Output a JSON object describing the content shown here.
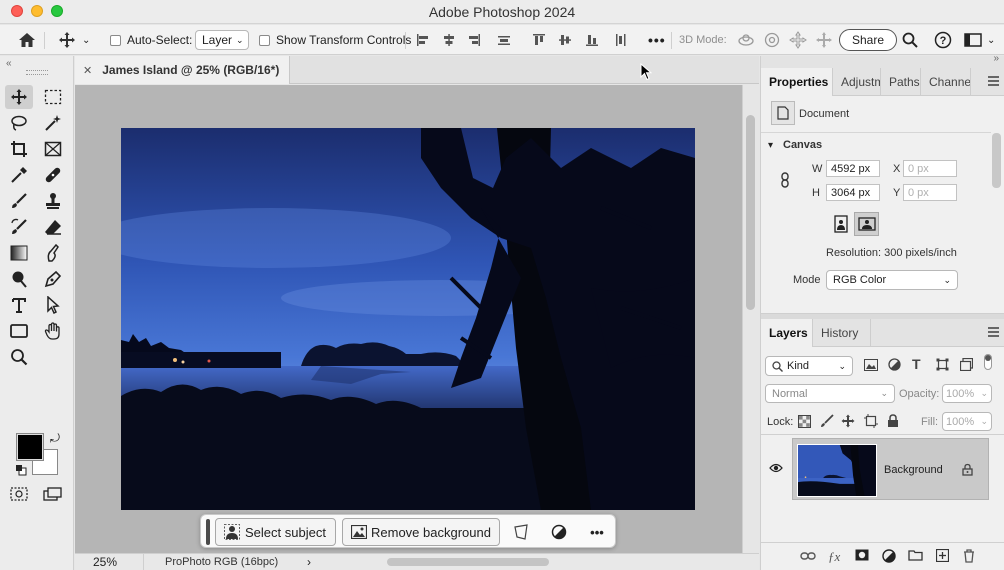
{
  "app": {
    "title": "Adobe Photoshop 2024"
  },
  "options_bar": {
    "auto_select_label": "Auto-Select:",
    "auto_select_value": "Layer",
    "show_transform_label": "Show Transform Controls",
    "mode_3d_label": "3D Mode:",
    "share_label": "Share",
    "more_label": "•••"
  },
  "document": {
    "tab_title": "James Island @ 25% (RGB/16*)",
    "close_glyph": "✕",
    "zoom": "25%",
    "color_profile": "ProPhoto RGB (16bpc)",
    "status_arrow": "›"
  },
  "contextual_taskbar": {
    "select_subject_label": "Select subject",
    "remove_background_label": "Remove background",
    "more_label": "•••"
  },
  "properties_panel": {
    "tabs": [
      "Properties",
      "Adjustm",
      "Paths",
      "Channe"
    ],
    "doc_label": "Document",
    "canvas_header": "Canvas",
    "width_label": "W",
    "width_value": "4592 px",
    "height_label": "H",
    "height_value": "3064 px",
    "x_label": "X",
    "x_placeholder": "0 px",
    "y_label": "Y",
    "y_placeholder": "0 px",
    "resolution": "Resolution: 300 pixels/inch",
    "mode_label": "Mode",
    "mode_value": "RGB Color"
  },
  "layers_panel": {
    "tabs": [
      "Layers",
      "History"
    ],
    "filter_kind": "Kind",
    "blend_mode": "Normal",
    "opacity_label": "Opacity:",
    "opacity_value": "100%",
    "lock_label": "Lock:",
    "fill_label": "Fill:",
    "fill_value": "100%",
    "layers": [
      {
        "name": "Background",
        "visible": true,
        "locked": true
      }
    ]
  },
  "colors": {
    "foreground": "#000000",
    "background": "#ffffff",
    "sky_top": "#1b2d6e",
    "sky_mid": "#3c64c8",
    "water": "#2f56b8"
  }
}
